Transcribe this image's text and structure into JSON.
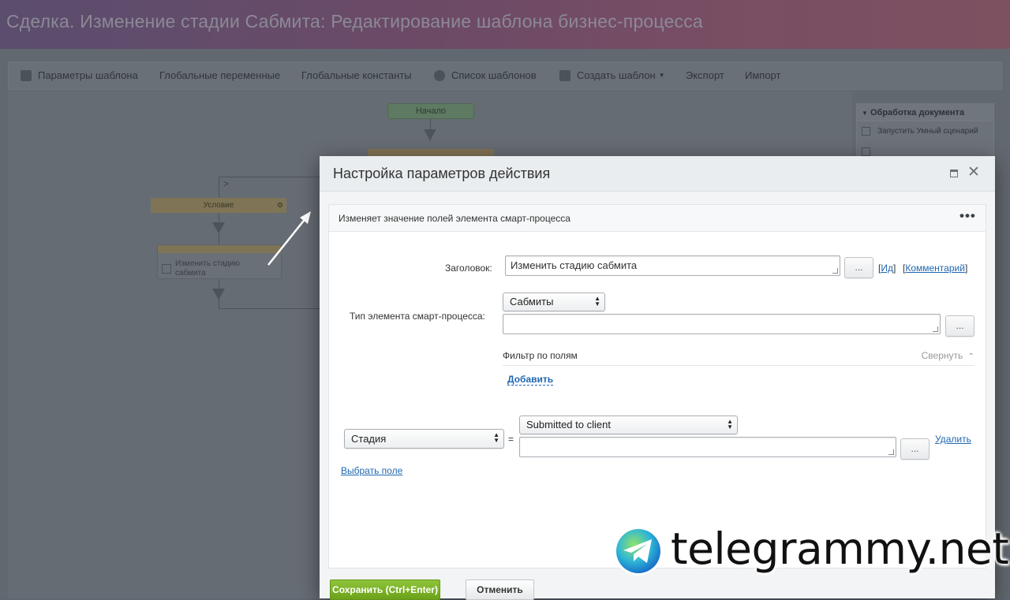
{
  "page": {
    "title": "Сделка. Изменение стадии Сабмита: Редактирование шаблона бизнес-процесса"
  },
  "toolbar": {
    "items": [
      {
        "label": "Параметры шаблона",
        "icon": "template-params-icon"
      },
      {
        "label": "Глобальные переменные"
      },
      {
        "label": "Глобальные константы"
      },
      {
        "label": "Список шаблонов",
        "icon": "template-list-icon"
      },
      {
        "label": "Создать шаблон",
        "icon": "create-template-icon"
      },
      {
        "label": "Экспорт"
      },
      {
        "label": "Импорт"
      }
    ]
  },
  "designer": {
    "start_label": "Начало",
    "condition_label": "Условие",
    "action_label": "Изменить стадию сабмита"
  },
  "right_panel": {
    "title": "Обработка документа",
    "items": [
      "Запустить Умный сценарий"
    ]
  },
  "dialog": {
    "title": "Настройка параметров действия",
    "description": "Изменяет значение полей элемента смарт-процесса",
    "more_label": "•••",
    "fields": {
      "title_label": "Заголовок:",
      "title_value": "Изменить стадию сабмита",
      "dots": "...",
      "id_link": "Ид",
      "comment_link": "Комментарий",
      "type_label": "Тип элемента смарт-процесса:",
      "type_value": "Сабмиты",
      "filter_title": "Фильтр по полям",
      "collapse_label": "Свернуть",
      "add_label": "Добавить",
      "field_select": "Стадия",
      "equals": "=",
      "stage_value": "Submitted to client",
      "delete_link": "Удалить",
      "choose_field_link": "Выбрать поле"
    },
    "buttons": {
      "save": "Сохранить (Ctrl+Enter)",
      "cancel": "Отменить"
    }
  },
  "watermark": {
    "text": "telegrammy.net"
  },
  "colors": {
    "save_green": "#6ba21a",
    "link_blue": "#2067b0",
    "overlay": "#62686f"
  }
}
